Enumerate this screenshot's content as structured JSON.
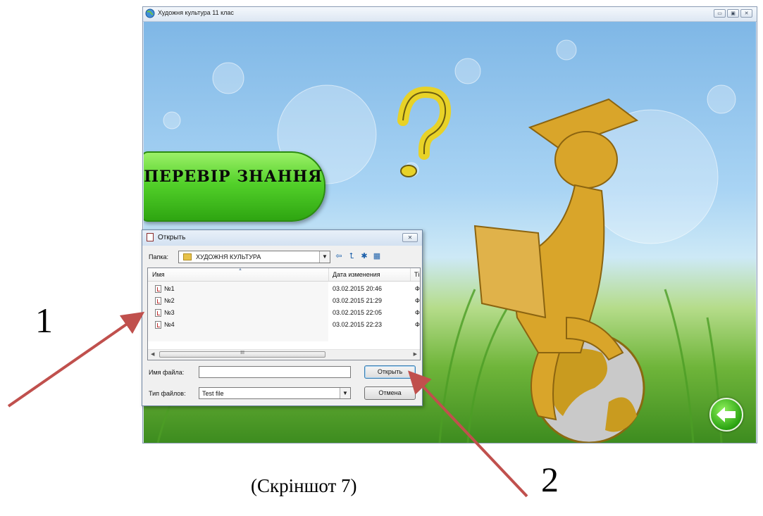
{
  "app": {
    "title": "Художня культура 11 клас",
    "window_buttons": {
      "minimize": "▭",
      "maximize": "▣",
      "close": "✕"
    }
  },
  "scene": {
    "check_button_label": "ПЕРЕВІР ЗНАННЯ",
    "back_button_icon": "arrow-left-icon"
  },
  "dialog": {
    "title": "Открыть",
    "close_glyph": "✕",
    "folder_label": "Папка:",
    "folder_value": "ХУДОЖНЯ КУЛЬТУРА",
    "toolbar_icons": [
      "back-icon",
      "up-folder-icon",
      "new-folder-icon",
      "view-menu-icon"
    ],
    "columns": {
      "name": "Имя",
      "modified": "Дата изменения",
      "type": "Ті"
    },
    "files": [
      {
        "name": "№1",
        "modified": "03.02.2015 20:46",
        "type": "Ф"
      },
      {
        "name": "№2",
        "modified": "03.02.2015 21:29",
        "type": "Ф"
      },
      {
        "name": "№3",
        "modified": "03.02.2015 22:05",
        "type": "Ф"
      },
      {
        "name": "№4",
        "modified": "03.02.2015 22:23",
        "type": "Ф"
      }
    ],
    "scrollbar_grip": "III",
    "filename_label": "Имя файла:",
    "filename_value": "",
    "filetype_label": "Тип файлов:",
    "filetype_value": "Test file",
    "open_button": "Открыть",
    "cancel_button": "Отмена"
  },
  "annotations": {
    "marker_1": "1",
    "marker_2": "2",
    "caption": "(Скріншот 7)",
    "arrow_color": "#c0504d"
  }
}
